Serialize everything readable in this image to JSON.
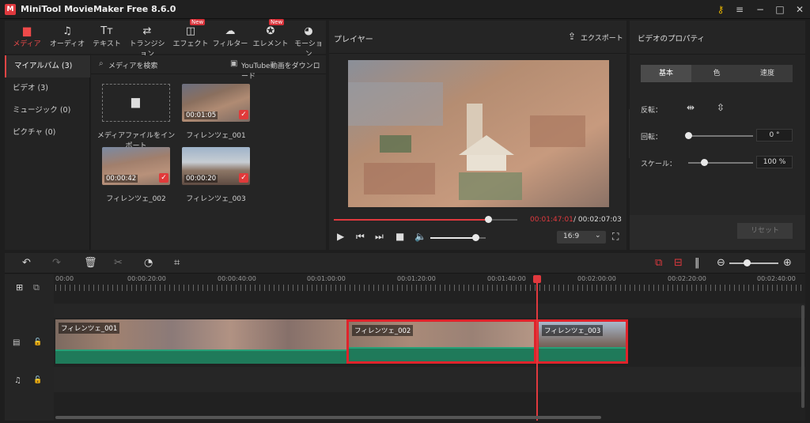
{
  "app": {
    "title": "MiniTool MovieMaker Free 8.6.0",
    "logo": "M"
  },
  "window_controls": {
    "key": "⚷",
    "menu": "≡",
    "minimize": "−",
    "maximize": "□",
    "close": "✕"
  },
  "toolbar": {
    "items": [
      {
        "label": "メディア",
        "icon": "folder-icon",
        "glyph": "▆"
      },
      {
        "label": "オーディオ",
        "icon": "music-icon",
        "glyph": "♫"
      },
      {
        "label": "テキスト",
        "icon": "text-icon",
        "glyph": "Tт"
      },
      {
        "label": "トランジション",
        "icon": "transition-icon",
        "glyph": "⇄"
      },
      {
        "label": "エフェクト",
        "icon": "effect-icon",
        "glyph": "◫",
        "badge": "New"
      },
      {
        "label": "フィルター",
        "icon": "filter-icon",
        "glyph": "☁"
      },
      {
        "label": "エレメント",
        "icon": "element-icon",
        "glyph": "✪",
        "badge": "New"
      },
      {
        "label": "モーション",
        "icon": "motion-icon",
        "glyph": "◕"
      }
    ]
  },
  "sidebar": {
    "items": [
      {
        "label": "マイアルバム (3)"
      },
      {
        "label": "ビデオ (3)"
      },
      {
        "label": "ミュージック (0)"
      },
      {
        "label": "ピクチャ (0)"
      }
    ]
  },
  "media": {
    "search_label": "メディアを検索",
    "download_label": "YouTube動画をダウンロード",
    "import_label": "メディアファイルをインポート",
    "files": [
      {
        "name": "フィレンツェ_001",
        "duration": "00:01:05"
      },
      {
        "name": "フィレンツェ_002",
        "duration": "00:00:42"
      },
      {
        "name": "フィレンツェ_003",
        "duration": "00:00:20"
      }
    ]
  },
  "player": {
    "title": "プレイヤー",
    "export_label": "エクスポート",
    "current_time": "00:01:47:01",
    "total_time": " / 00:02:07:03",
    "progress": 0.84,
    "volume": 0.82,
    "aspect": "16:9"
  },
  "properties": {
    "title": "ビデオのプロパティ",
    "tabs": [
      "基本",
      "色",
      "速度"
    ],
    "flip_label": "反転：",
    "rotate_label": "回転：",
    "rotate_value": "0 °",
    "scale_label": "スケール：",
    "scale_value": "100 %",
    "reset_label": "リセット"
  },
  "timeline": {
    "ruler": [
      "00:00",
      "00:00:20:00",
      "00:00:40:00",
      "00:01:00:00",
      "00:01:20:00",
      "00:01:40:00",
      "00:02:00:00",
      "00:02:20:00",
      "00:02:40:00"
    ],
    "clips": [
      {
        "name": "フィレンツェ_001"
      },
      {
        "name": "フィレンツェ_002"
      },
      {
        "name": "フィレンツェ_003"
      }
    ]
  },
  "colors": {
    "accent": "#e0393e",
    "audio_track": "#1f7a5a",
    "selection": "#e0232b"
  }
}
